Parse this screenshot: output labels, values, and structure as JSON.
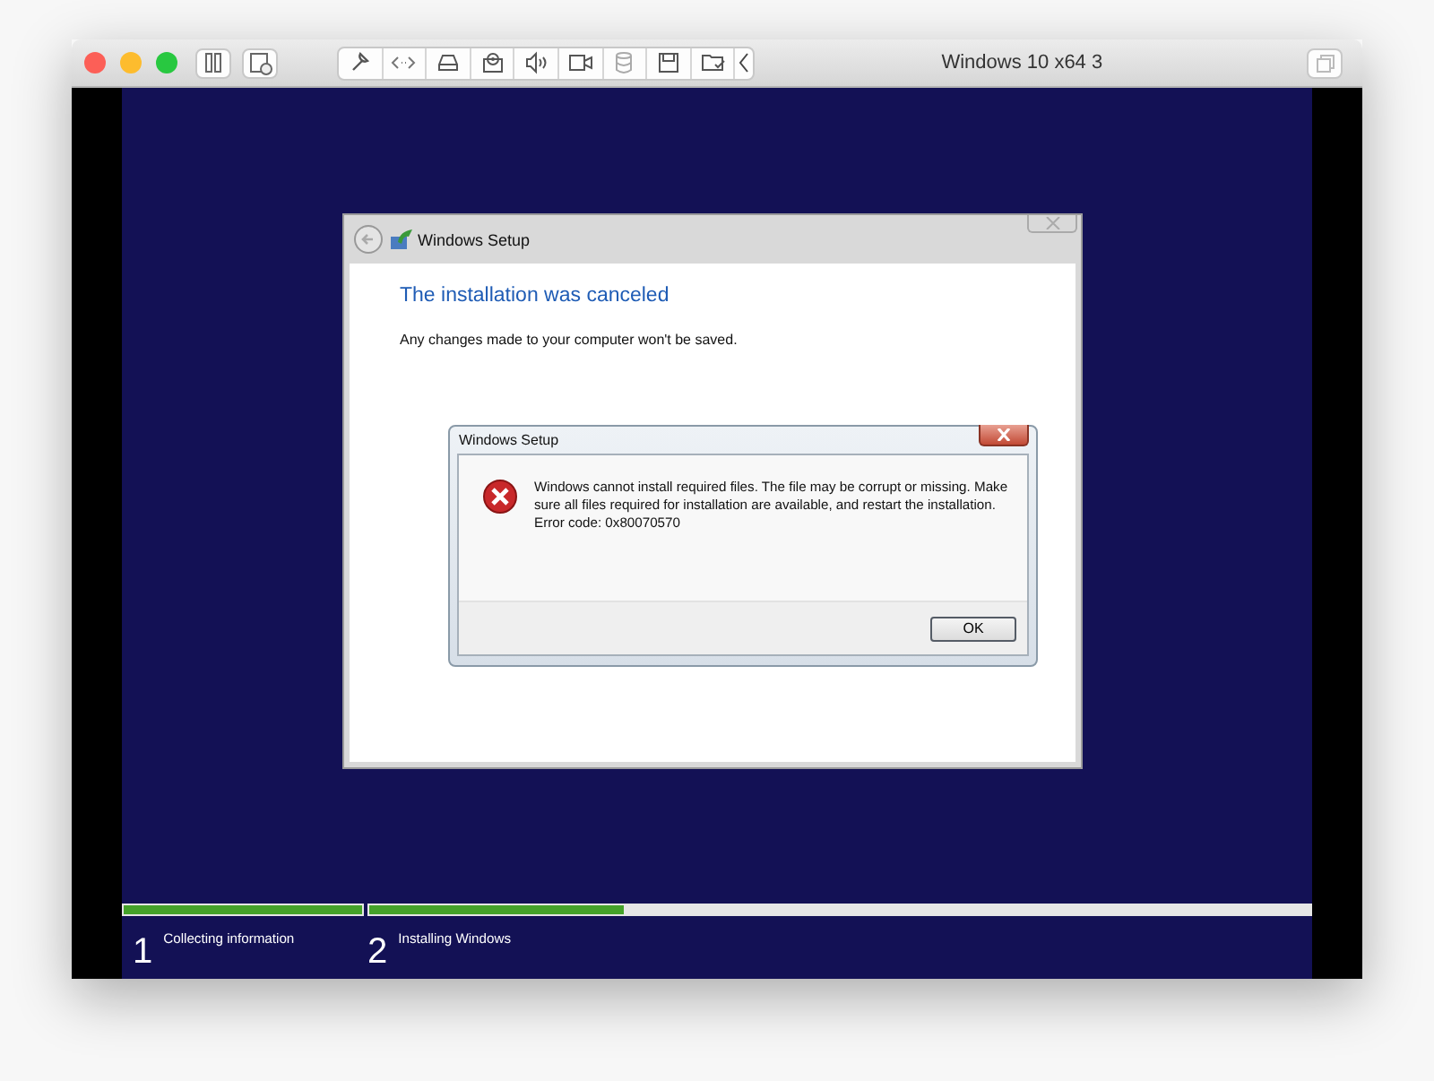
{
  "window": {
    "title": "Windows 10 x64 3"
  },
  "setup_window": {
    "title": "Windows Setup",
    "heading": "The installation was canceled",
    "message": "Any changes made to your computer won't be saved."
  },
  "error_dialog": {
    "title": "Windows Setup",
    "message": "Windows cannot install required files. The file may be corrupt or missing. Make sure all files required for installation are available, and restart the installation.",
    "error_code": "Error code: 0x80070570",
    "button": "OK"
  },
  "steps": [
    {
      "number": "1",
      "label": "Collecting information",
      "level": 1
    },
    {
      "number": "2",
      "label": "Installing Windows",
      "level": 0.27
    }
  ]
}
